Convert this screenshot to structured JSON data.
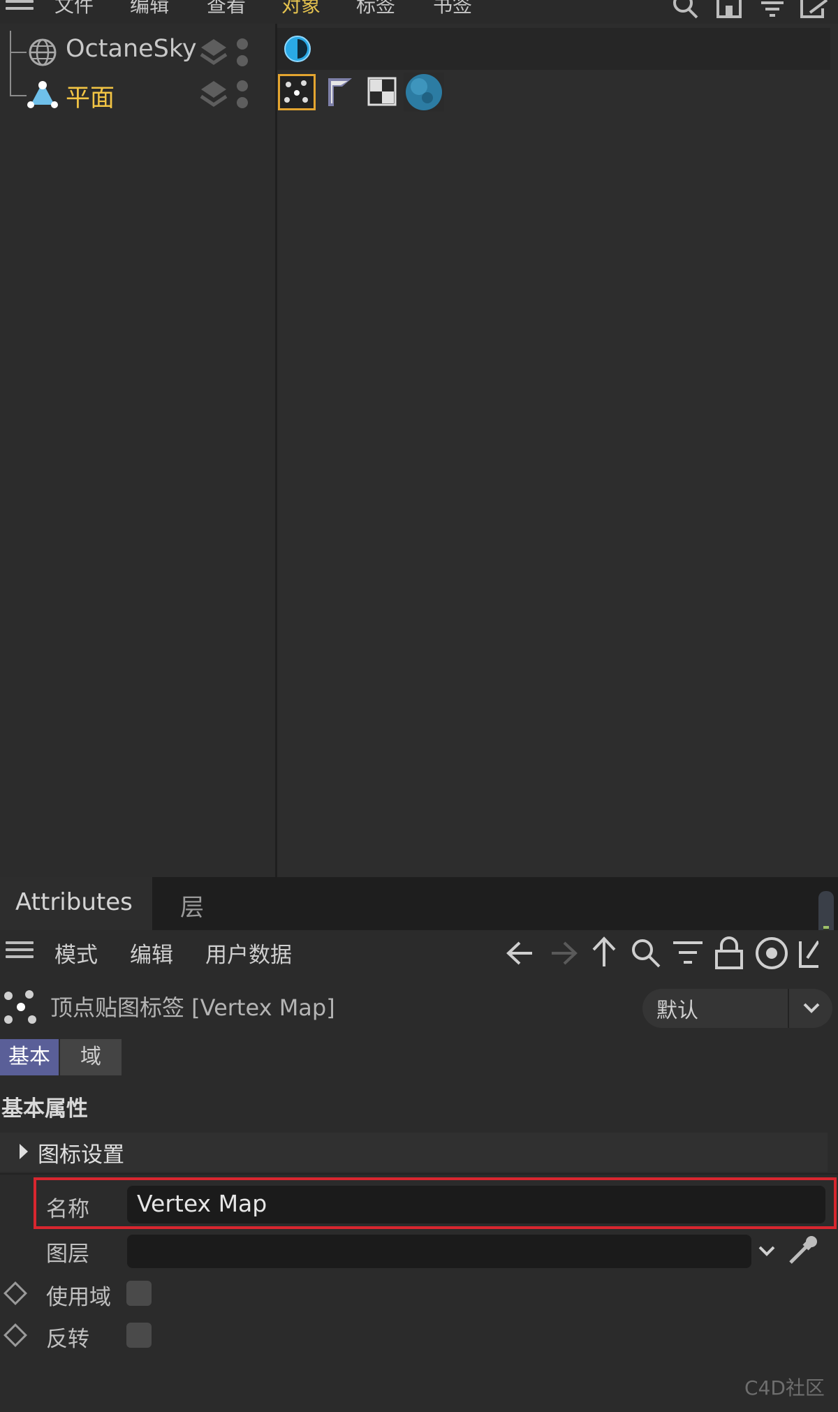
{
  "menu": [
    "文件",
    "编辑",
    "查看",
    "对象",
    "标签",
    "书签"
  ],
  "objects": [
    {
      "name": "OctaneSky",
      "color": "#c8c8c8"
    },
    {
      "name": "平面",
      "color": "#f3c544"
    }
  ],
  "attributes": {
    "tabs": [
      "Attributes",
      "层"
    ],
    "toolbar_menu": [
      "模式",
      "编辑",
      "用户数据"
    ],
    "object_title": "顶点贴图标签 [Vertex Map]",
    "preset_value": "默认",
    "prop_tabs": [
      "基本",
      "域"
    ],
    "section_title": "基本属性",
    "group_title": "图标设置",
    "fields": {
      "name_label": "名称",
      "name_value": "Vertex Map",
      "layer_label": "图层",
      "layer_value": "",
      "use_field_label": "使用域",
      "invert_label": "反转"
    }
  },
  "watermark": "C4D社区",
  "colors": {
    "accent_yellow": "#e4c24f",
    "highlight_red": "#d8262f",
    "tab_active": "#5a5f98",
    "octane_blue": "#2aa9e6"
  }
}
